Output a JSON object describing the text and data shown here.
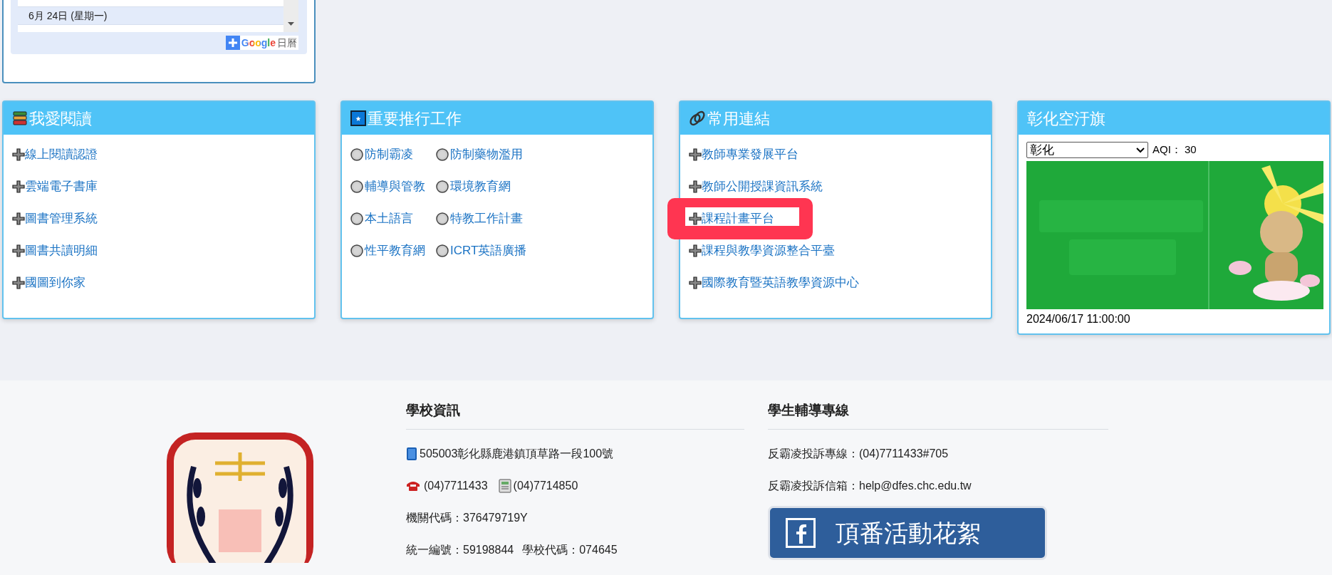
{
  "calendar": {
    "events": [
      {
        "date": "6月 24日 (星期一)",
        "selected": true
      }
    ],
    "add_button": {
      "brand": "Google",
      "label": "日曆"
    }
  },
  "cards": [
    {
      "kind": "list",
      "title": "我愛閱讀",
      "items": [
        {
          "label": "線上閱讀認證"
        },
        {
          "label": "雲端電子書庫"
        },
        {
          "label": "圖書管理系統"
        },
        {
          "label": "圖書共讀明細"
        },
        {
          "label": "國圖到你家"
        }
      ]
    },
    {
      "kind": "grid",
      "title": "重要推行工作",
      "items": [
        {
          "label": "防制霸凌"
        },
        {
          "label": "防制藥物濫用"
        },
        {
          "label": "輔導與管教"
        },
        {
          "label": "環境教育網"
        },
        {
          "label": "本土語言"
        },
        {
          "label": "特教工作計畫"
        },
        {
          "label": "性平教育網"
        },
        {
          "label": "ICRT英語廣播"
        }
      ]
    },
    {
      "kind": "list",
      "title": "常用連結",
      "items": [
        {
          "label": "教師專業發展平台",
          "highlighted": false
        },
        {
          "label": "教師公開授課資訊系統",
          "highlighted": false
        },
        {
          "label": "課程計畫平台",
          "highlighted": true
        },
        {
          "label": "課程與教學資源整合平臺",
          "highlighted": false
        },
        {
          "label": "國際教育暨英語教學資源中心",
          "highlighted": false
        }
      ]
    },
    {
      "kind": "aqi",
      "title": "彰化空汙旗",
      "select": "彰化",
      "aqi_label": "AQI：",
      "aqi_value": "30",
      "timestamp": "2024/06/17 11:00:00"
    }
  ],
  "footer": {
    "columns": [
      {
        "title": "學校資訊",
        "lines": [
          {
            "kind": "address",
            "text": "505003彰化縣鹿港鎮頂草路一段100號"
          },
          {
            "kind": "phones",
            "phone": "(04)7711433",
            "fax": "(04)7714850"
          },
          {
            "kind": "text",
            "text": "機關代碼：376479719Y"
          },
          {
            "kind": "pair",
            "first": "統一編號：59198844",
            "second": "學校代碼：074645"
          }
        ]
      },
      {
        "title": "學生輔導專線",
        "lines": [
          {
            "kind": "text",
            "text": "反霸凌投訴專線：(04)7711433#705"
          },
          {
            "kind": "text",
            "text": "反霸凌投訴信箱：help@dfes.chc.edu.tw"
          }
        ],
        "banner": "頂番活動花絮"
      }
    ]
  }
}
